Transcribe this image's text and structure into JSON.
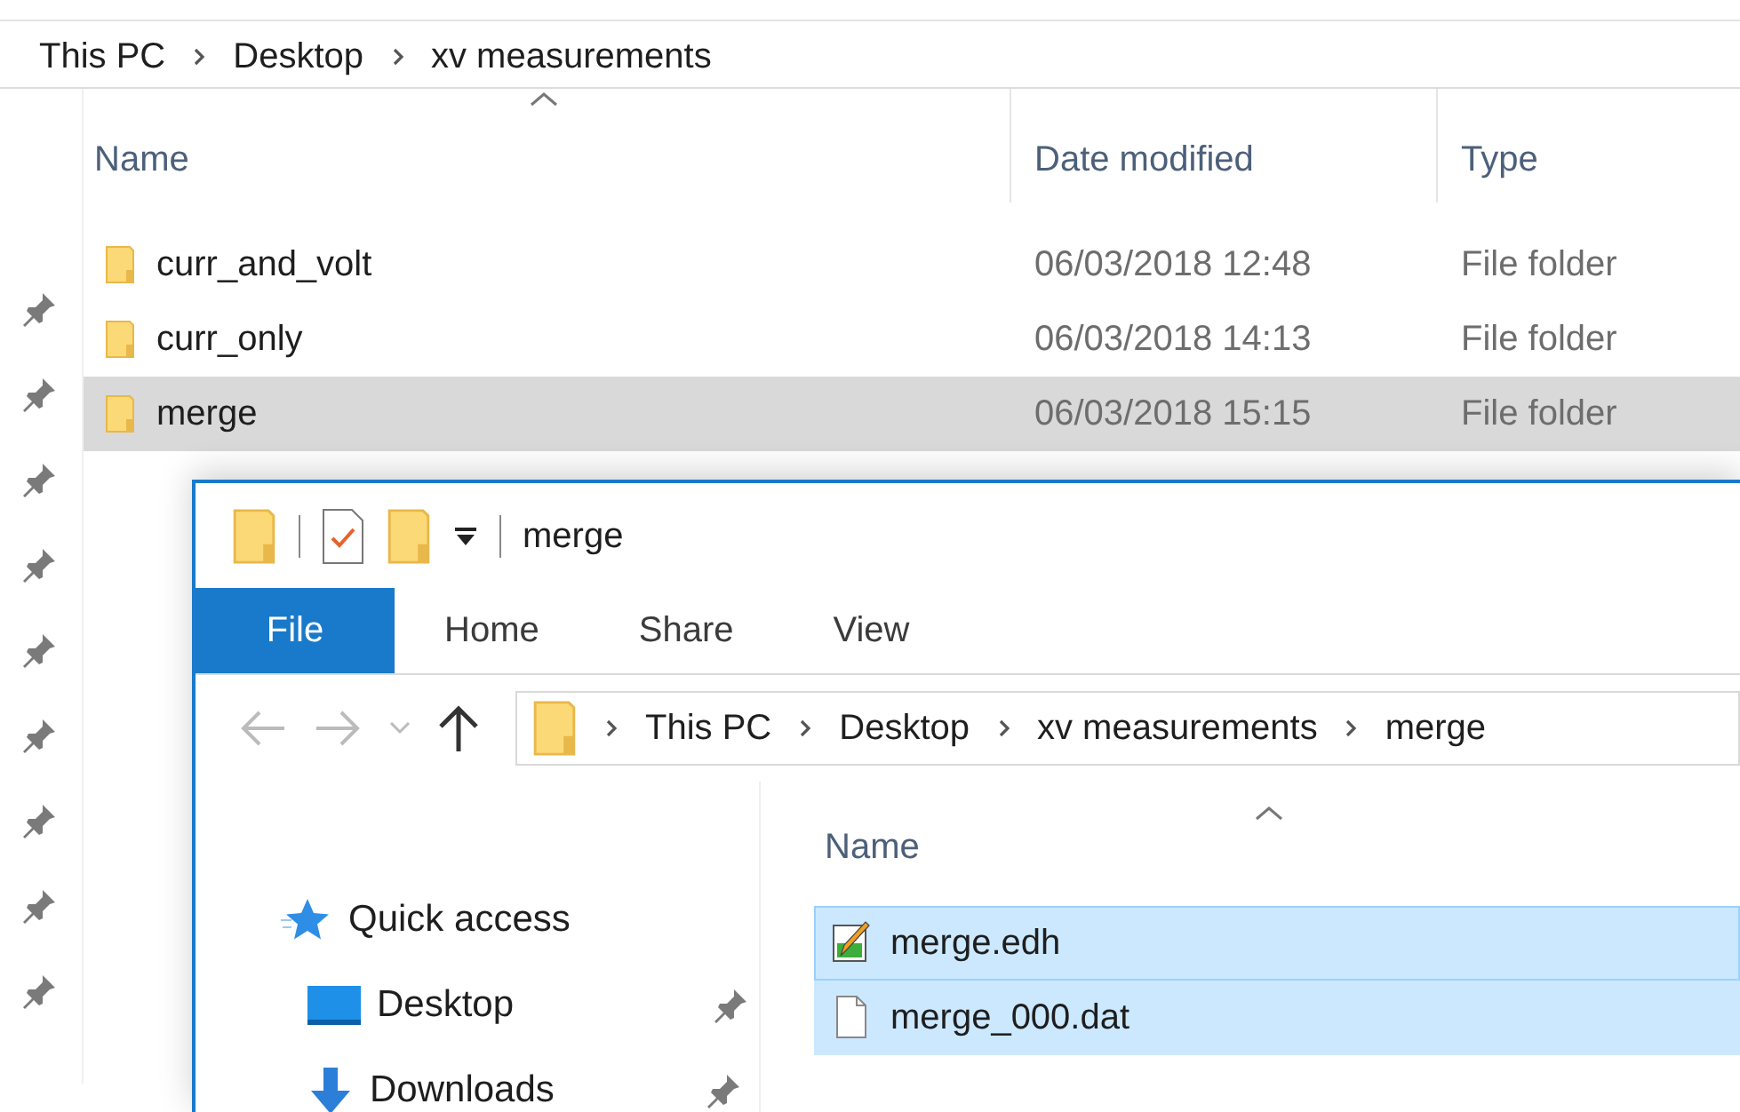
{
  "breadcrumb": [
    "This PC",
    "Desktop",
    "xv measurements"
  ],
  "columns": [
    {
      "label": "Name",
      "sorted": true
    },
    {
      "label": "Date modified",
      "sorted": false
    },
    {
      "label": "Type",
      "sorted": false
    }
  ],
  "rows": [
    {
      "name": "curr_and_volt",
      "date": "06/03/2018 12:48",
      "type": "File folder",
      "selected": false
    },
    {
      "name": "curr_only",
      "date": "06/03/2018 14:13",
      "type": "File folder",
      "selected": false
    },
    {
      "name": "merge",
      "date": "06/03/2018 15:15",
      "type": "File folder",
      "selected": true
    }
  ],
  "window": {
    "title": "merge",
    "ribbon_tabs": [
      {
        "label": "File",
        "selected": true
      },
      {
        "label": "Home",
        "selected": false
      },
      {
        "label": "Share",
        "selected": false
      },
      {
        "label": "View",
        "selected": false
      }
    ],
    "address": [
      "This PC",
      "Desktop",
      "xv measurements",
      "merge"
    ],
    "nav": [
      {
        "label": "Quick access",
        "kind": "quick",
        "pinned": false
      },
      {
        "label": "Desktop",
        "kind": "desktop",
        "pinned": true
      },
      {
        "label": "Downloads",
        "kind": "downloads",
        "pinned": true
      }
    ],
    "name_column": {
      "label": "Name",
      "sorted": true
    },
    "files": [
      {
        "name": "merge.edh",
        "kind": "notepad",
        "selected": true
      },
      {
        "name": "merge_000.dat",
        "kind": "blank",
        "selected": true
      }
    ]
  }
}
